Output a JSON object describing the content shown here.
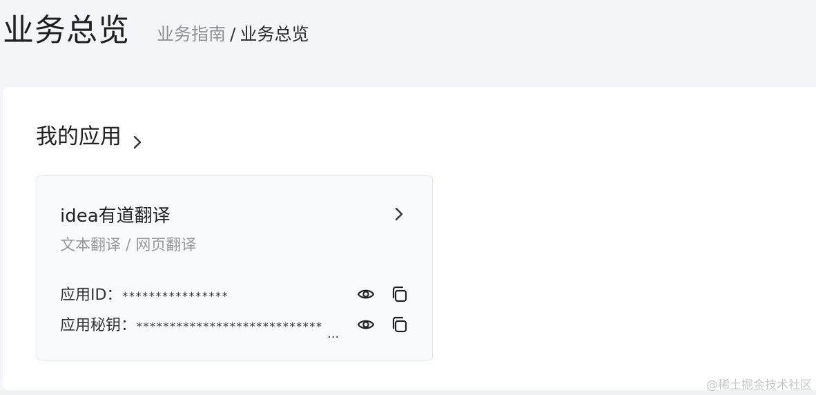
{
  "header": {
    "title": "业务总览",
    "breadcrumb": {
      "parent": "业务指南",
      "separator": "/",
      "current": "业务总览"
    }
  },
  "section": {
    "title": "我的应用",
    "chevron_icon": "chevron-right-icon"
  },
  "app_card": {
    "name": "idea有道翻译",
    "services": "文本翻译 / 网页翻译",
    "app_id": {
      "label": "应用ID：",
      "value": "****************",
      "show_icon": "eye-icon",
      "copy_icon": "copy-icon"
    },
    "app_secret": {
      "label": "应用秘钥：",
      "value": "****************************",
      "overflow": "...",
      "show_icon": "eye-icon",
      "copy_icon": "copy-icon"
    }
  },
  "watermark": "@稀土掘金技术社区",
  "colors": {
    "page_bg": "#f4f5f9",
    "panel_bg": "#ffffff",
    "card_bg": "#f9fafc",
    "muted_text": "#9a9a9a"
  }
}
